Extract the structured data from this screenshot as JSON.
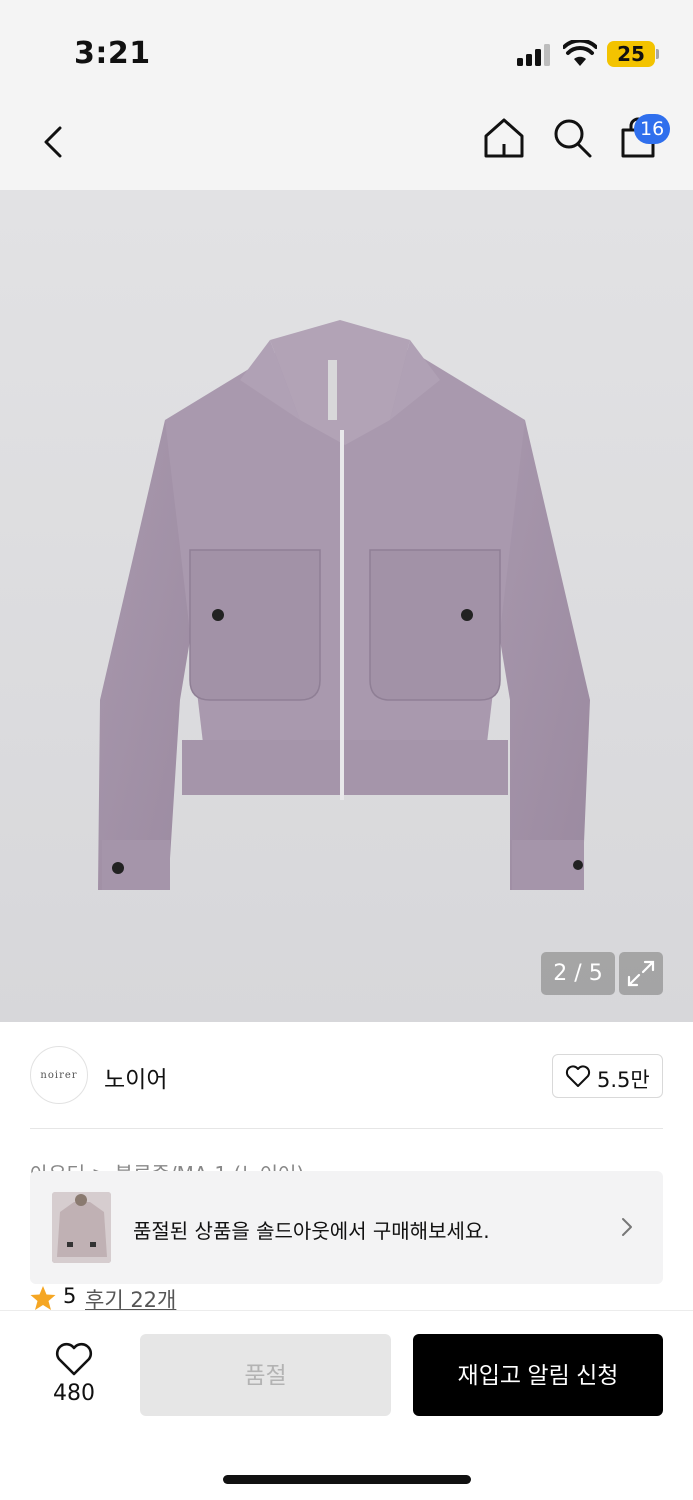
{
  "status_bar": {
    "time": "3:21",
    "battery": "25"
  },
  "nav": {
    "cart_count": "16"
  },
  "gallery": {
    "counter": "2 / 5"
  },
  "brand": {
    "logo_text": "noirer",
    "name": "노이어",
    "like_count": "5.5만"
  },
  "product": {
    "category": "아우터 > 블루종/MA-1 (노이어)"
  },
  "soldout_banner": {
    "text": "품절된 상품을 솔드아웃에서 구매해보세요."
  },
  "rating": {
    "value": "5",
    "review_label": "후기 22개"
  },
  "bottom_bar": {
    "wish_count": "480",
    "soldout_label": "품절",
    "restock_label": "재입고 알림 신청"
  },
  "colors": {
    "accent_badge": "#2f6fed",
    "battery": "#f3c300",
    "star": "#f5a623",
    "primary_button": "#000000"
  }
}
